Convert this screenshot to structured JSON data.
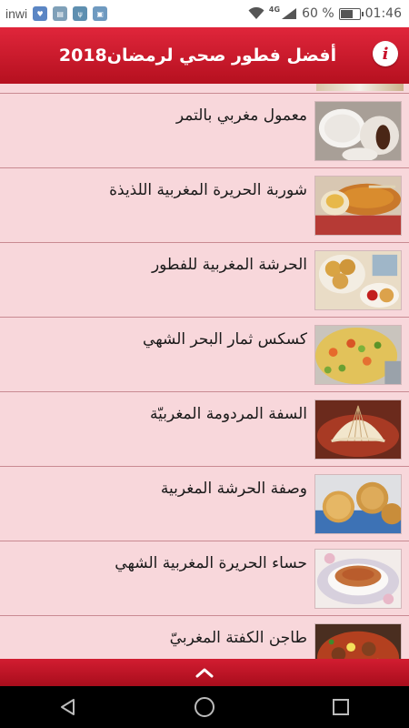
{
  "status_bar": {
    "carrier": "inwi",
    "network": "4G",
    "battery_percent": "60 %",
    "battery_level": 0.6,
    "time": "01:46",
    "notification_icons": [
      "health-app-icon",
      "app-icon",
      "usb-icon",
      "image-icon"
    ]
  },
  "app_bar": {
    "title": "أفضل فطور صحي لرمضان2018",
    "info_label": "i"
  },
  "list": {
    "items": [
      {
        "title": "معمول مغربي بالتمر",
        "thumb": "maamoul-dates"
      },
      {
        "title": "شوربة الحريرة المغربية اللذيذة",
        "thumb": "harira-soup"
      },
      {
        "title": "الحرشة المغربية للفطور",
        "thumb": "harcha-breakfast"
      },
      {
        "title": "كسكس ثمار البحر الشهي",
        "thumb": "seafood-couscous"
      },
      {
        "title": "السفة المردومة المغربيّة",
        "thumb": "seffa-medfouna"
      },
      {
        "title": "وصفة الحرشة المغربية",
        "thumb": "harcha-recipe"
      },
      {
        "title": "حساء الحريرة المغربية الشهي",
        "thumb": "harira-bowl"
      },
      {
        "title": "طاجن الكفتة المغربيّ",
        "thumb": "kefta-tagine"
      }
    ]
  },
  "colors": {
    "app_bar": "#c8122a",
    "list_background": "#f8d7db",
    "divider": "#c98a92"
  }
}
